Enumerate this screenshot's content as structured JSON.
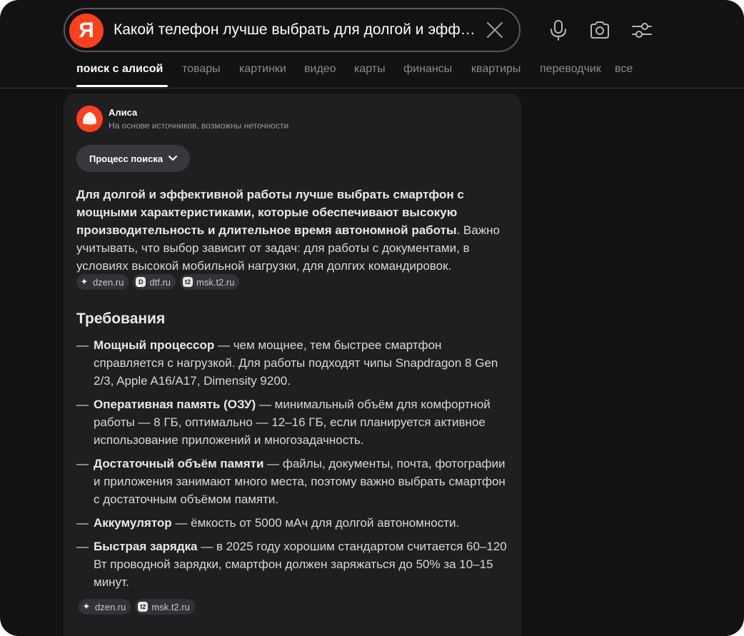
{
  "search": {
    "logo": "Я",
    "query": "Какой телефон лучше выбрать для долгой и эфф…"
  },
  "icons": [
    "clear-icon",
    "microphone-icon",
    "camera-icon",
    "settings-sliders-icon"
  ],
  "tabs": [
    {
      "label": "поиск с алисой",
      "active": true
    },
    {
      "label": "товары"
    },
    {
      "label": "картинки"
    },
    {
      "label": "видео"
    },
    {
      "label": "карты"
    },
    {
      "label": "финансы"
    },
    {
      "label": "квартиры"
    },
    {
      "label": "переводчик"
    },
    {
      "label": "все"
    }
  ],
  "alice": {
    "name": "Алиса",
    "note": "На основе источников, возможны неточности",
    "process_button": "Процесс поиска"
  },
  "answer": {
    "bold": "Для долгой и эффективной работы лучше выбрать смартфон с мощными характеристиками, которые обеспечивают высокую производительность и длительное время автономной работы",
    "rest": ". Важно учитывать, что выбор зависит от задач: для работы с документами, в условиях высокой мобильной нагрузки, для долгих командировок."
  },
  "sources_top": [
    "dzen.ru",
    "dtf.ru",
    "msk.t2.ru"
  ],
  "requirements": {
    "title": "Требования",
    "items": [
      {
        "term": "Мощный процессор",
        "text": " — чем мощнее, тем быстрее смартфон справляется с нагрузкой. Для работы подходят чипы Snapdragon 8 Gen 2/3, Apple A16/A17, Dimensity 9200."
      },
      {
        "term": "Оперативная память (ОЗУ)",
        "text": " — минимальный объём для комфортной работы — 8 ГБ, оптимально — 12–16 ГБ, если планируется активное использование приложений и многозадачность."
      },
      {
        "term": "Достаточный объём памяти",
        "text": " — файлы, документы, почта, фотографии и приложения занимают много места, поэтому важно выбрать смартфон с достаточным объёмом памяти."
      },
      {
        "term": "Аккумулятор",
        "text": " — ёмкость от 5000 мАч для долгой автономности."
      },
      {
        "term": "Быстрая зарядка",
        "text": " — в 2025 году хорошим стандартом считается 60–120 Вт проводной зарядки, смартфон должен заряжаться до 50% за 10–15 минут."
      }
    ],
    "dash": "—"
  },
  "sources_bottom": [
    "dzen.ru",
    "msk.t2.ru"
  ],
  "colors": {
    "brand": "#fc3f1d",
    "background": "#121213",
    "card": "#1f1f22"
  }
}
